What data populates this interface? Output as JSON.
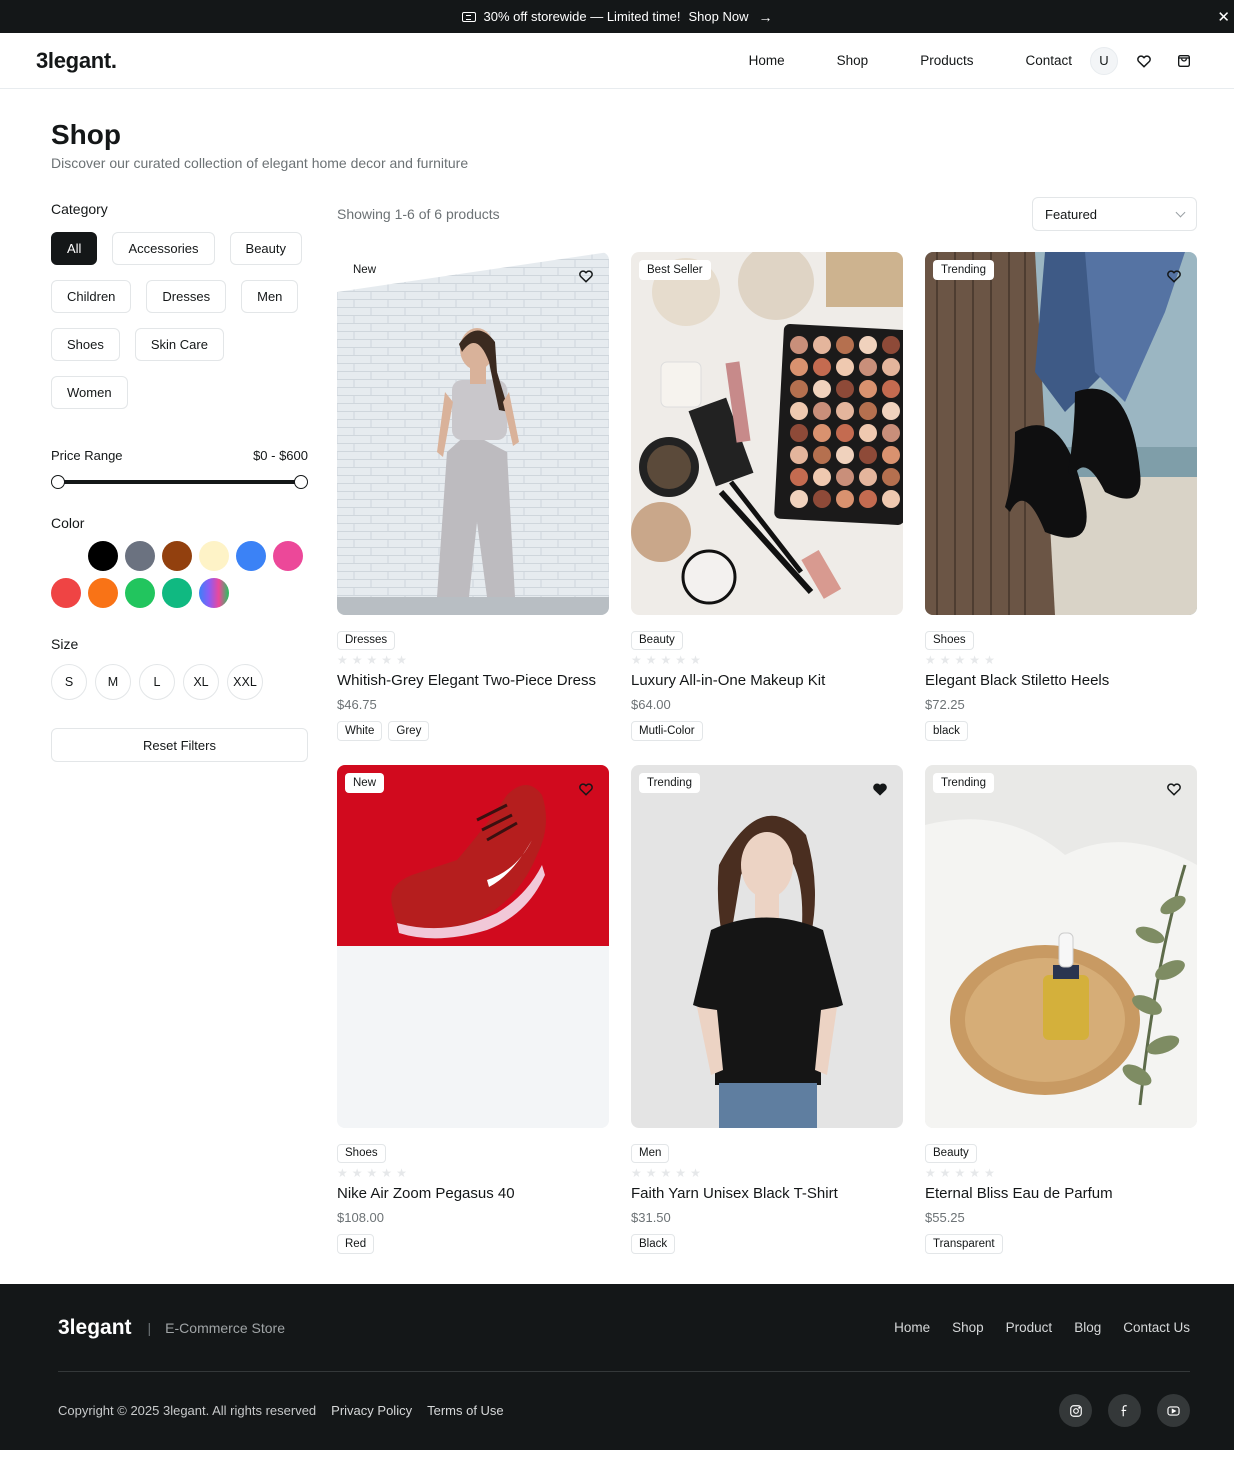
{
  "announcement": {
    "text": "30% off storewide — Limited time!",
    "cta": "Shop Now",
    "arrow": "→",
    "close": "✕"
  },
  "header": {
    "logo": "3legant.",
    "nav": [
      "Home",
      "Shop",
      "Products",
      "Contact"
    ],
    "avatar_initial": "U"
  },
  "page": {
    "title": "Shop",
    "subtitle": "Discover our curated collection of elegant home decor and furniture"
  },
  "filters": {
    "category_label": "Category",
    "categories": [
      "All",
      "Accessories",
      "Beauty",
      "Children",
      "Dresses",
      "Men",
      "Shoes",
      "Skin Care",
      "Women"
    ],
    "active_category": "All",
    "price_label": "Price Range",
    "price_value": "$0 - $600",
    "price_min": 0,
    "price_max": 600,
    "color_label": "Color",
    "colors": [
      "#ffffff",
      "#000000",
      "#6b7280",
      "#92400e",
      "#fef3c7",
      "#3b82f6",
      "#ec4899",
      "#ef4444",
      "#f97316",
      "#22c55e",
      "#10b981",
      "gradient"
    ],
    "size_label": "Size",
    "sizes": [
      "S",
      "M",
      "L",
      "XL",
      "XXL"
    ],
    "reset_label": "Reset Filters"
  },
  "toolbar": {
    "showing": "Showing 1-6 of 6 products",
    "sort": "Featured"
  },
  "products": [
    {
      "badge": "New",
      "category": "Dresses",
      "name": "Whitish-Grey Elegant Two-Piece Dress",
      "price": "$46.75",
      "variants": [
        "White",
        "Grey"
      ],
      "favorited": false,
      "image": "woman-in-grey-two-piece-dress"
    },
    {
      "badge": "Best Seller",
      "category": "Beauty",
      "name": "Luxury All-in-One Makeup Kit",
      "price": "$64.00",
      "variants": [
        "Mutli-Color"
      ],
      "favorited": false,
      "image": "makeup-palette-and-brushes"
    },
    {
      "badge": "Trending",
      "category": "Shoes",
      "name": "Elegant Black Stiletto Heels",
      "price": "$72.25",
      "variants": [
        "black"
      ],
      "favorited": false,
      "image": "black-stiletto-heels"
    },
    {
      "badge": "New",
      "category": "Shoes",
      "name": "Nike Air Zoom Pegasus 40",
      "price": "$108.00",
      "variants": [
        "Red"
      ],
      "favorited": false,
      "image": "red-running-shoe"
    },
    {
      "badge": "Trending",
      "category": "Men",
      "name": "Faith Yarn Unisex Black T-Shirt",
      "price": "$31.50",
      "variants": [
        "Black"
      ],
      "favorited": true,
      "image": "woman-in-black-tshirt"
    },
    {
      "badge": "Trending",
      "category": "Beauty",
      "name": "Eternal Bliss Eau de Parfum",
      "price": "$55.25",
      "variants": [
        "Transparent"
      ],
      "favorited": false,
      "image": "perfume-bottle-with-eucalyptus"
    }
  ],
  "footer": {
    "logo": "3legant",
    "separator": "|",
    "tagline": "E-Commerce Store",
    "nav": [
      "Home",
      "Shop",
      "Product",
      "Blog",
      "Contact Us"
    ],
    "copyright": "Copyright © 2025 3legant. All rights reserved",
    "privacy": "Privacy Policy",
    "terms": "Terms of Use",
    "socials": [
      "instagram-icon",
      "facebook-icon",
      "youtube-icon"
    ]
  }
}
